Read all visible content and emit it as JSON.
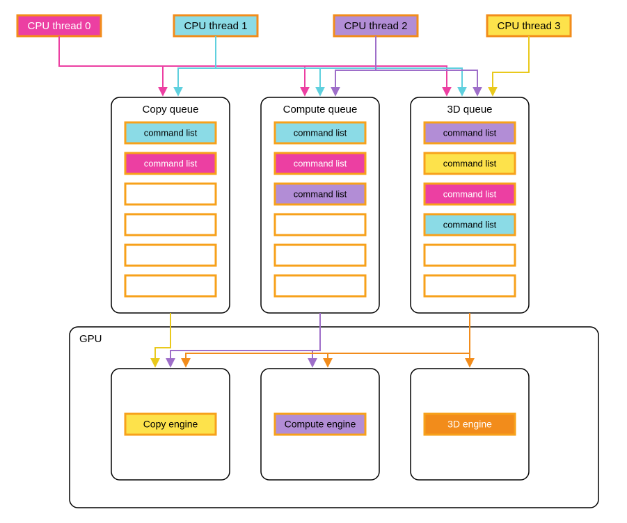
{
  "colors": {
    "pink": "#ec3fa2",
    "cyan": "#5fd0de",
    "purple": "#9e6ec9",
    "orange": "#f28c1b",
    "yellow": "#f5d519",
    "cyanFill": "#8bdbe6",
    "pinkFill": "#ec3fa2",
    "purpleFill": "#b28dd6",
    "yellowFill": "#fde24b",
    "orangeFill": "#f28c1b",
    "slotBorder": "#f7a11b"
  },
  "threads": [
    {
      "id": 0,
      "label": "CPU thread 0",
      "fill": "#ec3fa2",
      "stroke": "#f28c1b",
      "textColor": "#ffffff"
    },
    {
      "id": 1,
      "label": "CPU thread 1",
      "fill": "#8bdbe6",
      "stroke": "#f28c1b",
      "textColor": "#000000"
    },
    {
      "id": 2,
      "label": "CPU thread 2",
      "fill": "#b28dd6",
      "stroke": "#f28c1b",
      "textColor": "#000000"
    },
    {
      "id": 3,
      "label": "CPU thread 3",
      "fill": "#fde24b",
      "stroke": "#f28c1b",
      "textColor": "#000000"
    }
  ],
  "queues": [
    {
      "id": "copy",
      "label": "Copy queue",
      "slots": [
        {
          "label": "command list",
          "fill": "#8bdbe6"
        },
        {
          "label": "command list",
          "fill": "#ec3fa2"
        },
        {
          "label": "",
          "fill": "#ffffff"
        },
        {
          "label": "",
          "fill": "#ffffff"
        },
        {
          "label": "",
          "fill": "#ffffff"
        },
        {
          "label": "",
          "fill": "#ffffff"
        }
      ]
    },
    {
      "id": "compute",
      "label": "Compute queue",
      "slots": [
        {
          "label": "command list",
          "fill": "#8bdbe6"
        },
        {
          "label": "command list",
          "fill": "#ec3fa2"
        },
        {
          "label": "command list",
          "fill": "#b28dd6"
        },
        {
          "label": "",
          "fill": "#ffffff"
        },
        {
          "label": "",
          "fill": "#ffffff"
        },
        {
          "label": "",
          "fill": "#ffffff"
        }
      ]
    },
    {
      "id": "3d",
      "label": "3D queue",
      "slots": [
        {
          "label": "command list",
          "fill": "#b28dd6"
        },
        {
          "label": "command list",
          "fill": "#fde24b"
        },
        {
          "label": "command list",
          "fill": "#ec3fa2"
        },
        {
          "label": "command list",
          "fill": "#8bdbe6"
        },
        {
          "label": "",
          "fill": "#ffffff"
        },
        {
          "label": "",
          "fill": "#ffffff"
        }
      ]
    }
  ],
  "gpu": {
    "label": "GPU",
    "engines": [
      {
        "id": "copy",
        "label": "Copy engine",
        "fill": "#fde24b"
      },
      {
        "id": "compute",
        "label": "Compute engine",
        "fill": "#b28dd6"
      },
      {
        "id": "3d",
        "label": "3D engine",
        "fill": "#f28c1b"
      }
    ]
  },
  "arrows_threads_to_queues": [
    {
      "from": 0,
      "to": "copy",
      "color": "#ec3fa2"
    },
    {
      "from": 0,
      "to": "compute",
      "color": "#ec3fa2"
    },
    {
      "from": 0,
      "to": "3d",
      "color": "#ec3fa2"
    },
    {
      "from": 1,
      "to": "copy",
      "color": "#5fd0de"
    },
    {
      "from": 1,
      "to": "compute",
      "color": "#5fd0de"
    },
    {
      "from": 1,
      "to": "3d",
      "color": "#5fd0de"
    },
    {
      "from": 2,
      "to": "compute",
      "color": "#9e6ec9"
    },
    {
      "from": 2,
      "to": "3d",
      "color": "#9e6ec9"
    },
    {
      "from": 3,
      "to": "3d",
      "color": "#e9c91c"
    }
  ],
  "arrows_queues_to_engines": [
    {
      "from": "copy",
      "to": "copy",
      "color": "#e9c91c"
    },
    {
      "from": "compute",
      "to": "copy",
      "color": "#9e6ec9"
    },
    {
      "from": "compute",
      "to": "compute",
      "color": "#9e6ec9"
    },
    {
      "from": "3d",
      "to": "copy",
      "color": "#f28c1b"
    },
    {
      "from": "3d",
      "to": "compute",
      "color": "#f28c1b"
    },
    {
      "from": "3d",
      "to": "3d",
      "color": "#f28c1b"
    }
  ]
}
